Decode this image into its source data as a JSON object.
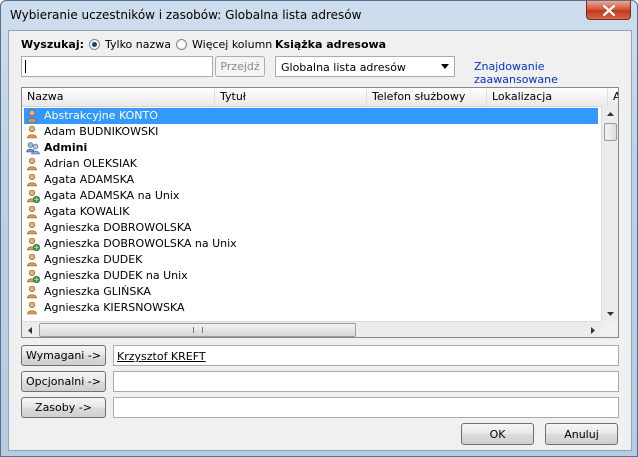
{
  "window": {
    "title": "Wybieranie uczestników i zasobów: Globalna lista adresów"
  },
  "search": {
    "label": "Wyszukaj:",
    "radio_name": "Tylko nazwa",
    "radio_more": "Więcej kolumn",
    "query": "",
    "go_button": "Przejdź"
  },
  "addressbook": {
    "label": "Książka adresowa",
    "selected": "Globalna lista adresów",
    "advanced_link": "Znajdowanie zaawansowane"
  },
  "table": {
    "columns": [
      "Nazwa",
      "Tytuł",
      "Telefon służbowy",
      "Lokalizacja",
      "A"
    ],
    "rows": [
      {
        "name": "Abstrakcyjne KONTO",
        "icon": "user-icon",
        "selected": true,
        "bold": false
      },
      {
        "name": "Adam BUDNIKOWSKI",
        "icon": "user-icon",
        "selected": false,
        "bold": false
      },
      {
        "name": "Admini",
        "icon": "group-icon",
        "selected": false,
        "bold": true
      },
      {
        "name": "Adrian OLEKSIAK",
        "icon": "user-icon",
        "selected": false,
        "bold": false
      },
      {
        "name": "Agata ADAMSKA",
        "icon": "user-icon",
        "selected": false,
        "bold": false
      },
      {
        "name": "Agata ADAMSKA na Unix",
        "icon": "external-user-icon",
        "selected": false,
        "bold": false
      },
      {
        "name": "Agata KOWALIK",
        "icon": "user-icon",
        "selected": false,
        "bold": false
      },
      {
        "name": "Agnieszka DOBROWOLSKA",
        "icon": "user-icon",
        "selected": false,
        "bold": false
      },
      {
        "name": "Agnieszka DOBROWOLSKA na Unix",
        "icon": "external-user-icon",
        "selected": false,
        "bold": false
      },
      {
        "name": "Agnieszka DUDEK",
        "icon": "user-icon",
        "selected": false,
        "bold": false
      },
      {
        "name": "Agnieszka DUDEK na Unix",
        "icon": "external-user-icon",
        "selected": false,
        "bold": false
      },
      {
        "name": "Agnieszka GLIŃSKA",
        "icon": "user-icon",
        "selected": false,
        "bold": false
      },
      {
        "name": "Agnieszka KIERSNOWSKA",
        "icon": "user-icon",
        "selected": false,
        "bold": false
      }
    ]
  },
  "recipients": {
    "required_button": "Wymagani ->",
    "required_value": "Krzysztof KREFT",
    "optional_button": "Opcjonalni ->",
    "optional_value": "",
    "resources_button": "Zasoby ->",
    "resources_value": ""
  },
  "footer": {
    "ok": "OK",
    "cancel": "Anuluj"
  },
  "colors": {
    "selection": "#3399ff",
    "link": "#0033cc"
  }
}
